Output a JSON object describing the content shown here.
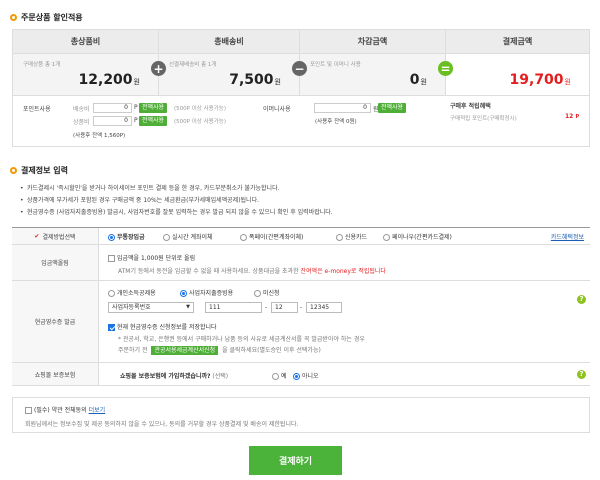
{
  "discount_section": {
    "title": "주문상품 할인적용"
  },
  "summary": [
    {
      "header": "총상품비",
      "sub": "구매상품 총 1개",
      "value": "12,200",
      "unit": "원"
    },
    {
      "header": "총배송비",
      "sub": "선결제배송비 총 1개",
      "value": "7,500",
      "unit": "원"
    },
    {
      "header": "차감금액",
      "sub": "포인트 및 이머니 사용",
      "value": "0",
      "unit": "원"
    },
    {
      "header": "결제금액",
      "sub": "",
      "value": "19,700",
      "unit": "원"
    }
  ],
  "operators": {
    "plus": "+",
    "minus": "−",
    "eq": "="
  },
  "points": {
    "label": "포인트사용",
    "delivery_label": "배송비",
    "delivery_value": "0",
    "delivery_unit": "P",
    "delivery_btn": "전액사용",
    "delivery_note": "(500P 이상 사용가능)",
    "product_label": "상품비",
    "product_value": "0",
    "product_unit": "P",
    "product_btn": "전액사용",
    "product_note": "(500P 이상 사용가능)",
    "balance": "(사용후 잔액 1,560P)",
    "emoney_label": "이머니사용",
    "emoney_value": "0",
    "emoney_unit": "원",
    "emoney_btn": "전액사용",
    "emoney_balance": "(사용후 잔액 0원)",
    "benefit_title": "구매후 적립혜택",
    "benefit_label": "구매적립 포인트(구매확정시)",
    "benefit_value": "12",
    "benefit_unit": "P"
  },
  "payment_section": {
    "title": "결제정보 입력"
  },
  "notes": [
    "카드결제시 '즉시할인'을 받거나 하이세이브 포인트 결제 등을 한 경우, 카드부분취소가 불가능합니다.",
    "상품가격에 부가세가 포함된 경우 구매금액 중 10%는 세금환급(부가세매입세액공제)됩니다.",
    "현금영수증 (사업자지출증빙용) 발급시, 사업자번호를 잘못 입력하는 경우 발급 되지 않을 수 있으니 확인 후 입력바랍니다."
  ],
  "method": {
    "label": "결제방법선택",
    "options": [
      "무통장입금",
      "실시간 계좌이체",
      "폭페이(간편계좌이체)",
      "신용카드",
      "페이나우(간편카드결제)"
    ],
    "selected": "무통장입금",
    "card_benefit_link": "카드혜택정보"
  },
  "deposit": {
    "label": "입금액올림",
    "check_text": "입금액을 1,000원 단위로 올림",
    "desc": "ATM기 등에서 동전을 입금할 수 없을 때 사용하세요. 상품대금을 초과한",
    "desc_red": "잔여액은 e-money로 적립됩니다"
  },
  "receipt": {
    "label": "현금영수증 발급",
    "options": [
      "개인소득공제용",
      "사업자지출증빙용",
      "미신청"
    ],
    "selected": "사업자지출증빙용",
    "select_text": "사업자등록번호",
    "num1": "111",
    "sep": "-",
    "num2": "12",
    "num3": "12345",
    "save_check": "현재 현금영수증 신청정보를 저장합니다",
    "note1": "* 관공서, 학교, 은행권 등에서 구매하거나 납품 등의 사유로 세금계산서를 꼭 발급받아야 하는 경우",
    "note2_pre": "주문하기 전",
    "note2_btn": "관공서용세금계산서신청",
    "note2_post": "을 클릭하세요(별도승인 이후 선택가능)"
  },
  "insurance": {
    "label": "쇼핑몰 보증보험",
    "question": "쇼핑몰 보증보험에 가입하겠습니까?",
    "select_hint": "(선택)",
    "yes": "예",
    "no": "아니오",
    "selected": "아니오"
  },
  "agreement": {
    "check_text": "(필수) 약관 전체동의",
    "link": "더보기",
    "desc": "회원님께서는 정보수집 및 제공 동의하지 않을 수 있으나, 동의를 거부할 경우 상품결제 및 배송이 제한됩니다."
  },
  "help_icon": "?",
  "pay_button": "결제하기",
  "colors": {
    "accent_green": "#4bb33a",
    "price_red": "#e41e1e",
    "ring_orange": "#f39800",
    "radio_blue": "#1a73e8"
  }
}
